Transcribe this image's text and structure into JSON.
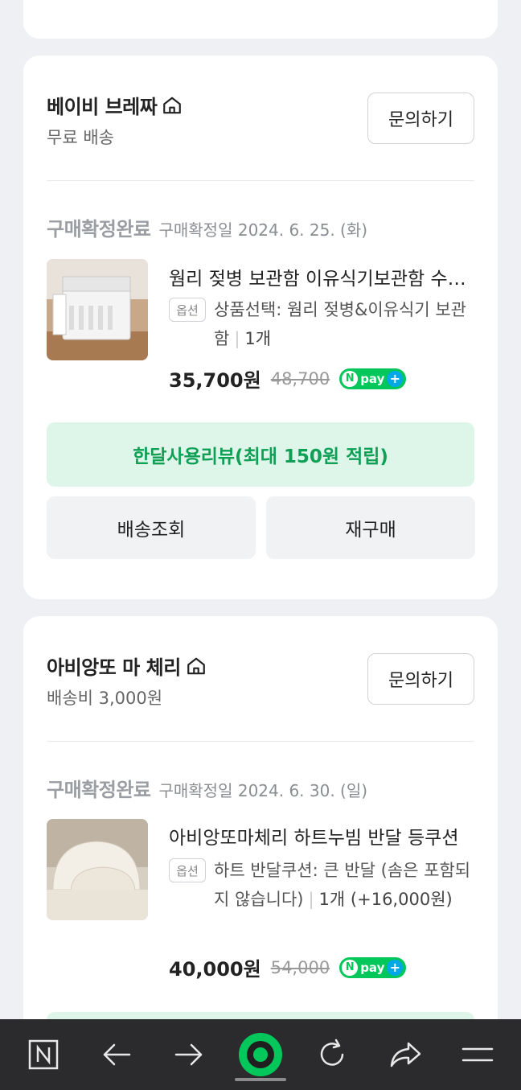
{
  "orders": [
    {
      "seller_name": "베이비 브레짜",
      "shipping": "무료 배송",
      "inquiry_label": "문의하기",
      "status": "구매확정완료",
      "status_date": "구매확정일 2024. 6. 25. (화)",
      "product_title": "웜리 젖병 보관함 이유식기보관함 수납장",
      "option_badge": "옵션",
      "option_text": "상품선택: 웜리 젖병&이유식기 보관함",
      "quantity": "1개",
      "quantity_extra": "",
      "price": "35,700원",
      "original_price": "48,700",
      "review_label": "한달사용리뷰(최대 150원 적립)",
      "shipping_lookup_label": "배송조회",
      "rebuy_label": "재구매"
    },
    {
      "seller_name": "아비앙또 마 체리",
      "shipping": "배송비 3,000원",
      "inquiry_label": "문의하기",
      "status": "구매확정완료",
      "status_date": "구매확정일 2024. 6. 30. (일)",
      "product_title": "아비앙또마체리 하트누빔 반달 등쿠션",
      "option_badge": "옵션",
      "option_text": "하트 반달쿠션: 큰 반달 (솜은 포함되지 않습니다)",
      "quantity": "1개",
      "quantity_extra": "(+16,000원)",
      "price": "40,000원",
      "original_price": "54,000"
    }
  ],
  "npay_label": "pay",
  "npay_n": "N",
  "npay_plus": "+",
  "bottom_nav": {
    "icons": [
      "naver-n-icon",
      "back-arrow-icon",
      "forward-arrow-icon",
      "green-dot-icon",
      "refresh-icon",
      "share-icon",
      "menu-icon"
    ]
  },
  "colors": {
    "accent_green": "#03c75a",
    "review_bg": "#def5e9",
    "review_text": "#0f9f55",
    "background": "#eef0f3"
  }
}
